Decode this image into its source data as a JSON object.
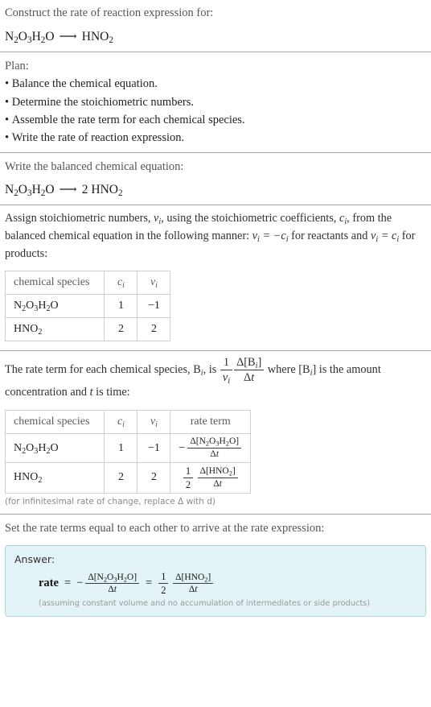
{
  "header": {
    "prompt": "Construct the rate of reaction expression for:",
    "equation": {
      "reactant": "N2O3H2O",
      "arrow": "⟶",
      "product": "HNO2"
    }
  },
  "plan": {
    "label": "Plan:",
    "steps": [
      "Balance the chemical equation.",
      "Determine the stoichiometric numbers.",
      "Assemble the rate term for each chemical species.",
      "Write the rate of reaction expression."
    ]
  },
  "balanced": {
    "label": "Write the balanced chemical equation:",
    "reactant": "N2O3H2O",
    "arrow": "⟶",
    "product_coefficient": "2",
    "product": "HNO2"
  },
  "stoich": {
    "intro_part1": "Assign stoichiometric numbers, ",
    "nu_i": "νi",
    "intro_part2": ", using the stoichiometric coefficients, ",
    "c_i": "ci",
    "intro_part3": ", from the balanced chemical equation in the following manner: ",
    "rule_reactants": "νi = −ci",
    "intro_part4": " for reactants and ",
    "rule_products": "νi = ci",
    "intro_part5": " for products:",
    "table": {
      "headers": [
        "chemical species",
        "ci",
        "νi"
      ],
      "rows": [
        {
          "species": "N2O3H2O",
          "c": "1",
          "nu": "−1"
        },
        {
          "species": "HNO2",
          "c": "2",
          "nu": "2"
        }
      ]
    }
  },
  "rate_term": {
    "intro_part1": "The rate term for each chemical species, ",
    "species_symbol": "Bi",
    "intro_part2": ", is ",
    "formula": {
      "num1": "1",
      "den1": "νi",
      "num2": "Δ[Bi]",
      "den2": "Δt"
    },
    "intro_part3": " where [Bi] is the amount concentration and ",
    "time_symbol": "t",
    "intro_part4": " is time:",
    "table": {
      "headers": [
        "chemical species",
        "ci",
        "νi",
        "rate term"
      ],
      "rows": [
        {
          "species": "N2O3H2O",
          "c": "1",
          "nu": "−1",
          "rate_sign": "−",
          "rate_coeff_num": "",
          "rate_coeff_den": "",
          "rate_num": "Δ[N2O3H2O]",
          "rate_den": "Δt"
        },
        {
          "species": "HNO2",
          "c": "2",
          "nu": "2",
          "rate_sign": "",
          "rate_coeff_num": "1",
          "rate_coeff_den": "2",
          "rate_num": "Δ[HNO2]",
          "rate_den": "Δt"
        }
      ]
    },
    "footnote": "(for infinitesimal rate of change, replace Δ with d)"
  },
  "final": {
    "label": "Set the rate terms equal to each other to arrive at the rate expression:",
    "answer": {
      "title": "Answer:",
      "rate_word": "rate",
      "equals": "=",
      "sign": "−",
      "left_num": "Δ[N2O3H2O]",
      "left_den": "Δt",
      "equals2": "=",
      "coeff_num": "1",
      "coeff_den": "2",
      "right_num": "Δ[HNO2]",
      "right_den": "Δt",
      "note": "(assuming constant volume and no accumulation of intermediates or side products)"
    }
  }
}
